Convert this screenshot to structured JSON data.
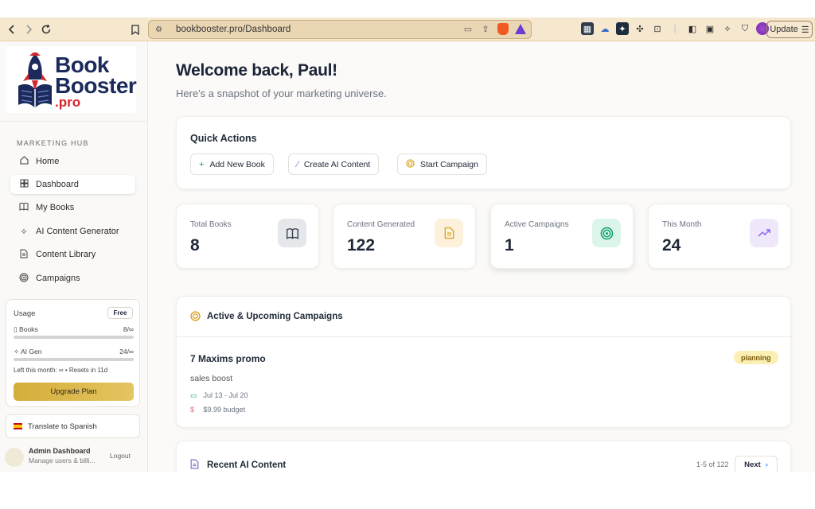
{
  "browser": {
    "url": "bookbooster.pro/Dashboard",
    "update_label": "Update"
  },
  "sidebar": {
    "logo": {
      "line1": "Book",
      "line2": "Booster",
      "line3": ".pro"
    },
    "section_label": "MARKETING HUB",
    "items": [
      {
        "label": "Home",
        "icon": "home-icon"
      },
      {
        "label": "Dashboard",
        "icon": "grid-icon",
        "active": true
      },
      {
        "label": "My Books",
        "icon": "book-open-icon"
      },
      {
        "label": "AI Content Generator",
        "icon": "sparkles-icon"
      },
      {
        "label": "Content Library",
        "icon": "document-icon"
      },
      {
        "label": "Campaigns",
        "icon": "target-icon"
      }
    ],
    "usage": {
      "title": "Usage",
      "plan_badge": "Free",
      "books_label": "Books",
      "books_value": "8/∞",
      "ai_label": "AI Gen",
      "ai_value": "24/∞",
      "note": "Left this month: ∞ • Resets in 11d",
      "upgrade_label": "Upgrade Plan"
    },
    "translate_label": "Translate to Spanish",
    "admin": {
      "name": "Admin Dashboard",
      "subtitle": "Manage users & billi...",
      "logout_label": "Logout"
    }
  },
  "main": {
    "welcome": "Welcome back, Paul!",
    "subtitle": "Here's a snapshot of your marketing universe.",
    "quick_actions": {
      "title": "Quick Actions",
      "buttons": [
        {
          "label": "Add New Book",
          "icon": "plus-icon"
        },
        {
          "label": "Create AI Content",
          "icon": "magic-wand-icon"
        },
        {
          "label": "Start Campaign",
          "icon": "target-icon"
        }
      ]
    },
    "stats": [
      {
        "label": "Total Books",
        "value": "8",
        "icon": "book-open-icon",
        "color": "#e5e7eb"
      },
      {
        "label": "Content Generated",
        "value": "122",
        "icon": "document-icon",
        "color": "#fdf1dc"
      },
      {
        "label": "Active Campaigns",
        "value": "1",
        "icon": "target-icon",
        "color": "#dcf5ea"
      },
      {
        "label": "This Month",
        "value": "24",
        "icon": "trending-up-icon",
        "color": "#efe8fb"
      }
    ],
    "campaigns": {
      "title": "Active & Upcoming Campaigns",
      "items": [
        {
          "name": "7 Maxims promo",
          "goal": "sales boost",
          "dates": "Jul 13 - Jul 20",
          "budget": "$9.99 budget",
          "status": "planning"
        }
      ]
    },
    "recent": {
      "title": "Recent AI Content",
      "pager": "1-5 of 122",
      "next_label": "Next"
    }
  }
}
